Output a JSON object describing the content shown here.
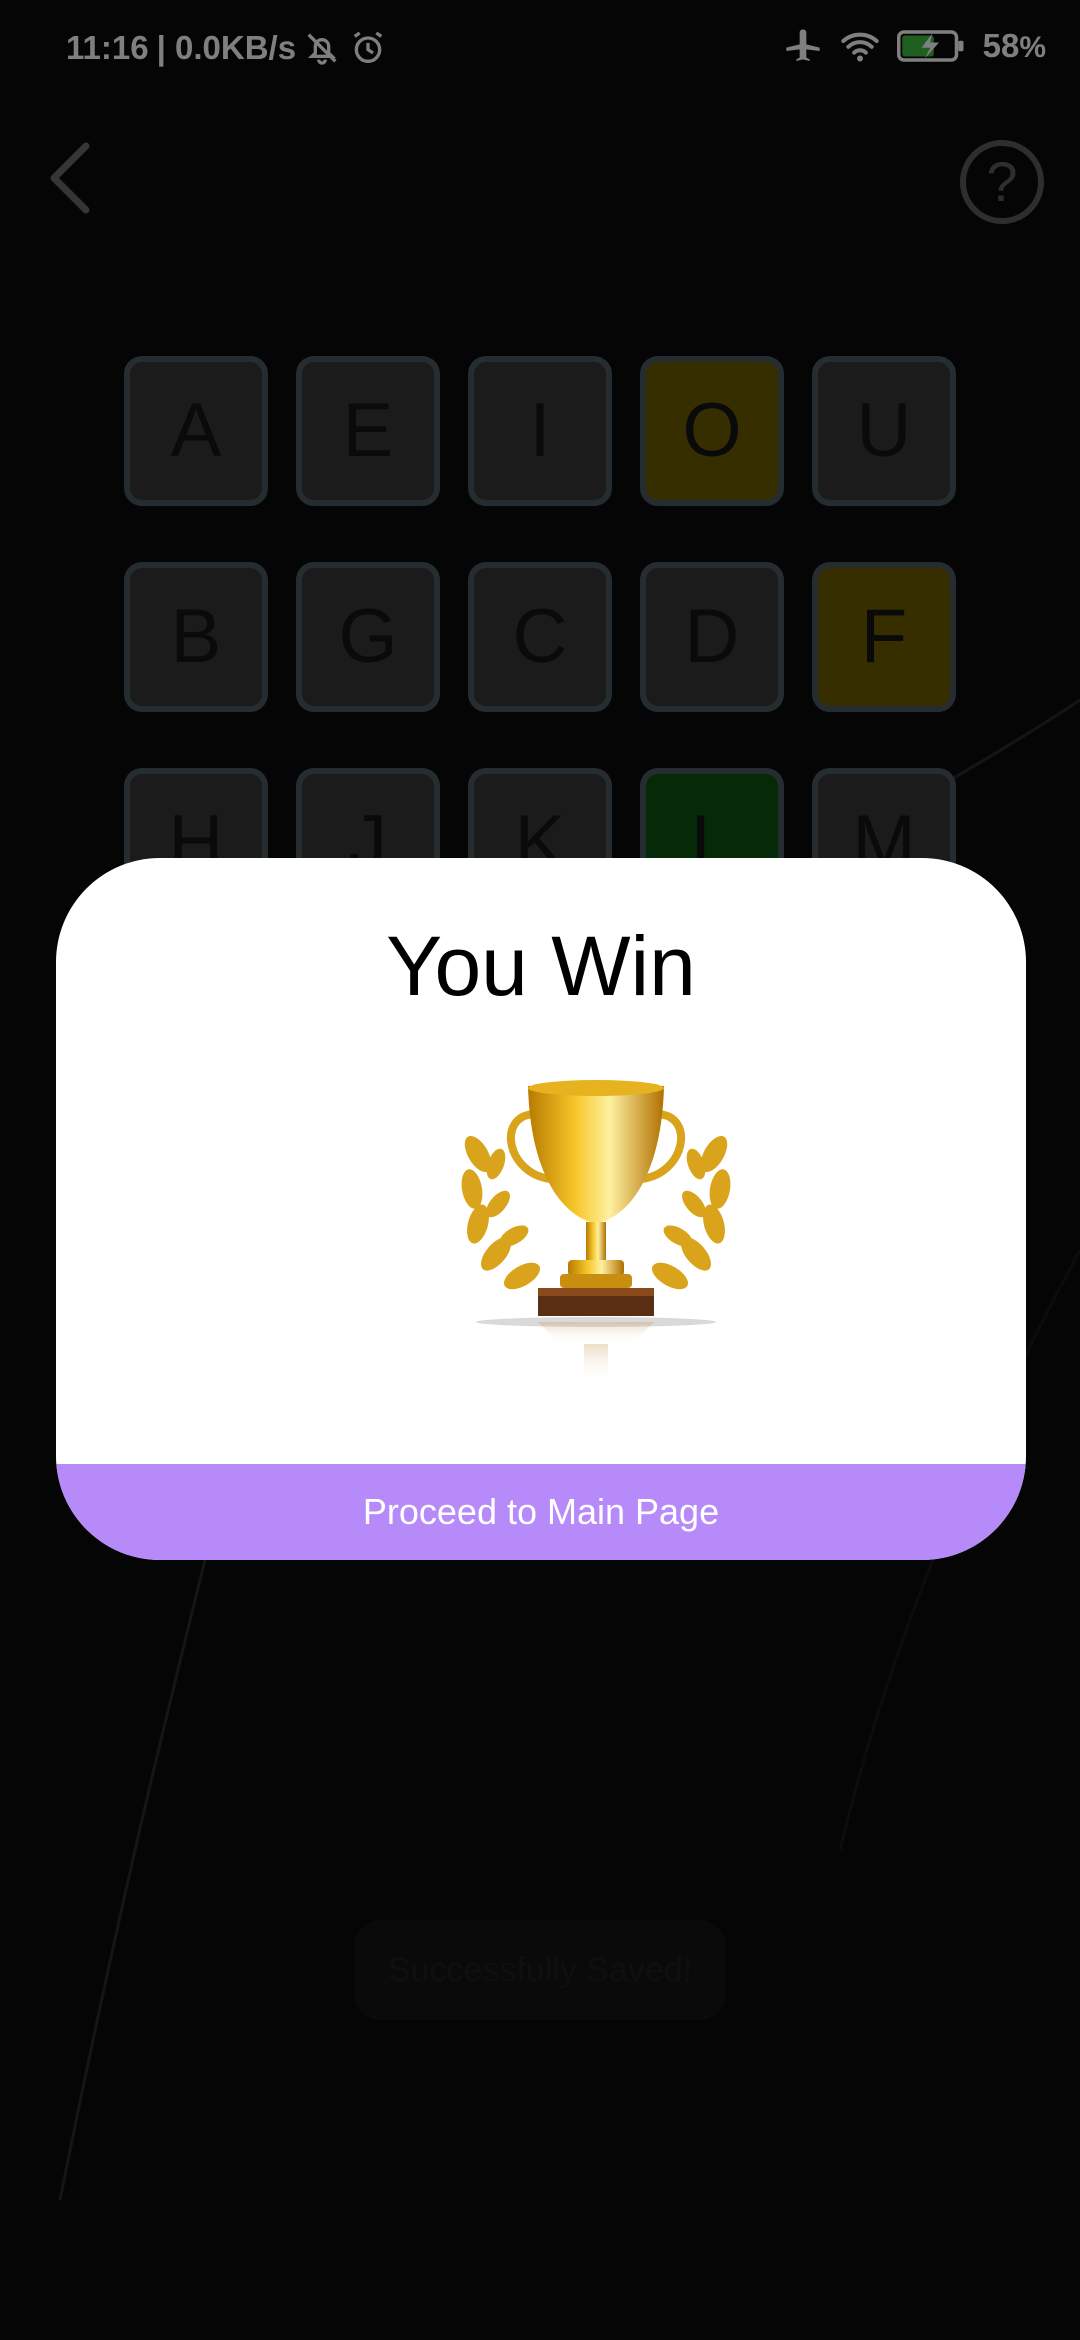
{
  "status_bar": {
    "time": "11:16",
    "net_speed": "| 0.0KB/s",
    "battery": "58",
    "battery_unit": "%"
  },
  "header": {
    "back_icon": "chevron-left-icon",
    "help_icon": "help-circle-icon",
    "help_glyph": "?"
  },
  "keyboard": {
    "rows": [
      [
        {
          "letter": "A",
          "state": "gray"
        },
        {
          "letter": "E",
          "state": "gray"
        },
        {
          "letter": "I",
          "state": "gray"
        },
        {
          "letter": "O",
          "state": "yellow"
        },
        {
          "letter": "U",
          "state": "gray"
        }
      ],
      [
        {
          "letter": "B",
          "state": "gray"
        },
        {
          "letter": "G",
          "state": "gray"
        },
        {
          "letter": "C",
          "state": "gray"
        },
        {
          "letter": "D",
          "state": "gray"
        },
        {
          "letter": "F",
          "state": "yellow"
        }
      ],
      [
        {
          "letter": "H",
          "state": "gray"
        },
        {
          "letter": "J",
          "state": "gray"
        },
        {
          "letter": "K",
          "state": "gray"
        },
        {
          "letter": "L",
          "state": "green"
        },
        {
          "letter": "M",
          "state": "gray"
        }
      ]
    ],
    "colors": {
      "gray": "#363636",
      "yellow": "#6e5c00",
      "green": "#0d5210"
    }
  },
  "toast": {
    "text": "Successfully Saved!"
  },
  "dialog": {
    "title": "You Win",
    "trophy_icon": "trophy-icon",
    "button_label": "Proceed to Main Page",
    "button_color": "#b68af8"
  }
}
